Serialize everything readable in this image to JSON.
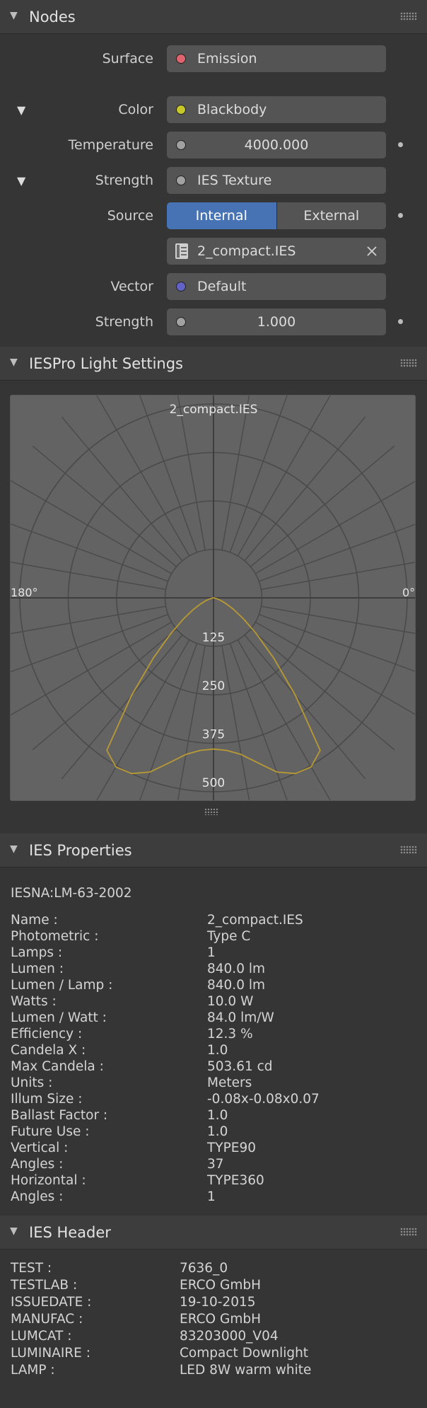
{
  "nodes": {
    "title": "Nodes",
    "surface": {
      "label": "Surface",
      "value": "Emission",
      "socket_color": "#e06470"
    },
    "color": {
      "label": "Color",
      "value": "Blackbody",
      "socket_color": "#c7c729"
    },
    "temperature": {
      "label": "Temperature",
      "value": "4000.000",
      "socket_color": "#a1a1a1"
    },
    "strength_texture": {
      "label": "Strength",
      "value": "IES Texture",
      "socket_color": "#a1a1a1"
    },
    "source": {
      "label": "Source",
      "options": [
        "Internal",
        "External"
      ],
      "selected": "Internal"
    },
    "file": {
      "value": "2_compact.IES"
    },
    "vector": {
      "label": "Vector",
      "value": "Default",
      "socket_color": "#6363c7"
    },
    "strength": {
      "label": "Strength",
      "value": "1.000",
      "socket_color": "#a1a1a1"
    }
  },
  "light_settings": {
    "title": "IESPro Light Settings"
  },
  "chart_data": {
    "type": "polar",
    "title": "2_compact.IES",
    "angle_labels": [
      "180°",
      "0°"
    ],
    "radial_ticks": [
      "125",
      "250",
      "375",
      "500"
    ],
    "rmax": 500,
    "curve_color": "#b89a34",
    "series": [
      {
        "angles_deg": [
          0,
          5,
          10,
          15,
          20,
          25,
          30,
          35,
          40,
          45,
          50,
          55,
          60,
          65,
          70,
          75,
          80,
          85,
          90
        ],
        "candela": [
          390,
          395,
          410,
          440,
          478,
          500,
          503.61,
          480,
          330,
          220,
          145,
          95,
          60,
          36,
          20,
          9,
          3,
          1,
          0
        ]
      }
    ]
  },
  "ies_properties": {
    "title": "IES Properties",
    "format": "IESNA:LM-63-2002",
    "rows": [
      {
        "key": "Name :",
        "value": "2_compact.IES"
      },
      {
        "key": "Photometric :",
        "value": "Type C"
      },
      {
        "key": "Lamps :",
        "value": "1"
      },
      {
        "key": "Lumen :",
        "value": "840.0 lm"
      },
      {
        "key": "Lumen / Lamp :",
        "value": "840.0 lm"
      },
      {
        "key": "Watts :",
        "value": "10.0 W"
      },
      {
        "key": "Lumen / Watt :",
        "value": "84.0 lm/W"
      },
      {
        "key": "Efficiency :",
        "value": "12.3  %"
      },
      {
        "key": "Candela X :",
        "value": "1.0"
      },
      {
        "key": "Max Candela :",
        "value": "503.61 cd"
      },
      {
        "key": "Units :",
        "value": "Meters"
      },
      {
        "key": "Illum Size :",
        "value": "-0.08x-0.08x0.07"
      },
      {
        "key": "Ballast Factor :",
        "value": "1.0"
      },
      {
        "key": "Future Use :",
        "value": "1.0"
      },
      {
        "key": "Vertical :",
        "value": "TYPE90"
      },
      {
        "key": "Angles :",
        "value": "37"
      },
      {
        "key": "Horizontal :",
        "value": "TYPE360"
      },
      {
        "key": "Angles :",
        "value": "1"
      }
    ]
  },
  "ies_header": {
    "title": "IES Header",
    "rows": [
      {
        "key": "TEST :",
        "value": "7636_0"
      },
      {
        "key": "TESTLAB :",
        "value": "ERCO GmbH"
      },
      {
        "key": "ISSUEDATE :",
        "value": "19-10-2015"
      },
      {
        "key": "MANUFAC :",
        "value": "ERCO GmbH"
      },
      {
        "key": "LUMCAT :",
        "value": "83203000_V04"
      },
      {
        "key": "LUMINAIRE :",
        "value": "Compact Downlight"
      },
      {
        "key": "LAMP :",
        "value": "LED 8W warm white"
      }
    ]
  }
}
